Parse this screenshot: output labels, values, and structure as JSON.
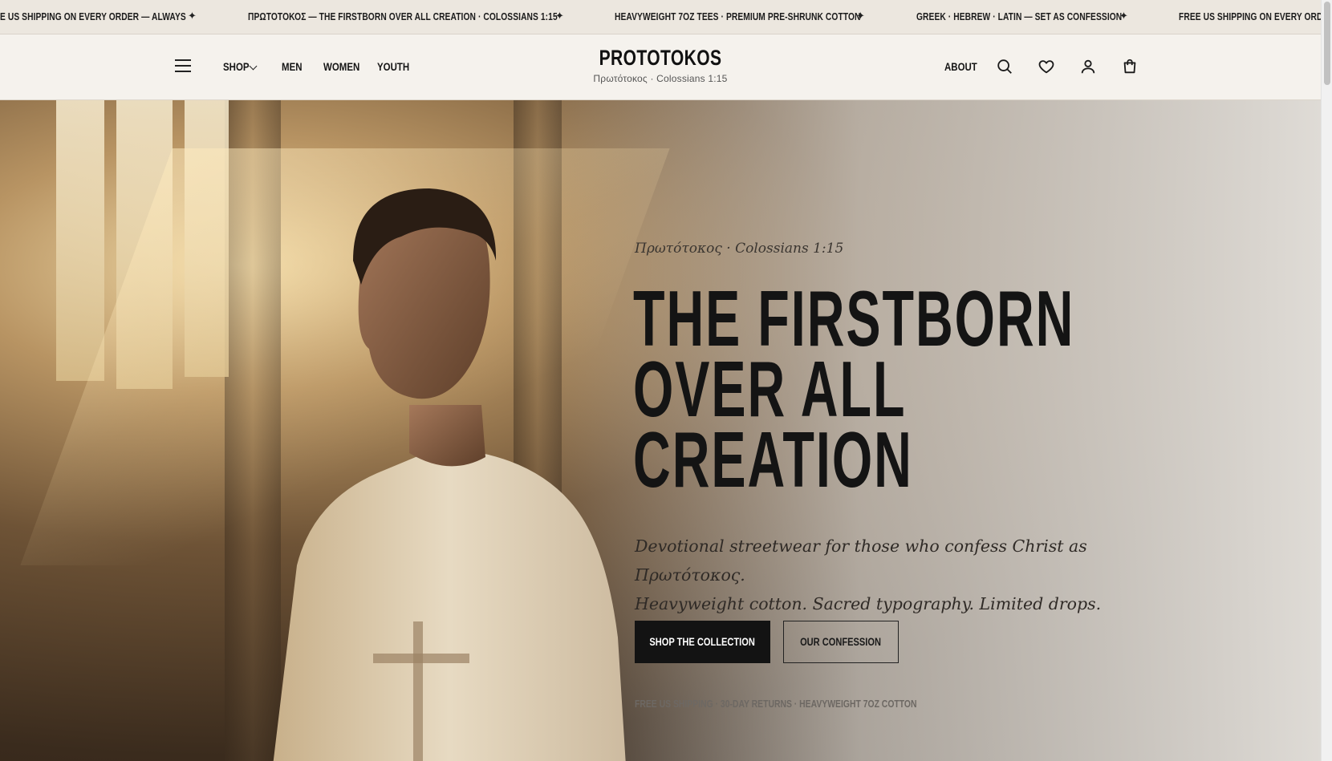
{
  "announcement": {
    "messages": [
      "E US SHIPPING ON EVERY ORDER — ALWAYS",
      "ΠΡΩΤΟΤΟΚΟΣ — THE FIRSTBORN OVER ALL CREATION · COLOSSIANS 1:15",
      "HEAVYWEIGHT 7OZ TEES · PREMIUM PRE-SHRUNK COTTON",
      "GREEK · HEBREW · LATIN — SET AS CONFESSION",
      "FREE US SHIPPING ON EVERY ORDER —"
    ],
    "separator": "✦"
  },
  "header": {
    "brand": "PROTOTOKOS",
    "brand_sub": "Πρωτότοκος · Colossians 1:15",
    "nav": {
      "shop": "SHOP",
      "men": "MEN",
      "women": "WOMEN",
      "youth": "YOUTH",
      "about": "ABOUT"
    },
    "icons": [
      "menu-icon",
      "chevron-down-icon",
      "search-icon",
      "heart-icon",
      "user-icon",
      "cart-icon"
    ]
  },
  "hero": {
    "eyebrow": "Πρωτότοκος · Colossians 1:15",
    "headline": [
      "THE FIRSTBORN",
      "OVER ALL",
      "CREATION"
    ],
    "tagline_line1": "Devotional streetwear for those who confess Christ as Πρωτότοκος.",
    "tagline_line2": "Heavyweight cotton. Sacred typography. Limited drops.",
    "primary_cta": "SHOP THE COLLECTION",
    "secondary_cta": "OUR CONFESSION",
    "perks": "FREE US SHIPPING · 30-DAY RETURNS · HEAVYWEIGHT 7OZ COTTON"
  }
}
